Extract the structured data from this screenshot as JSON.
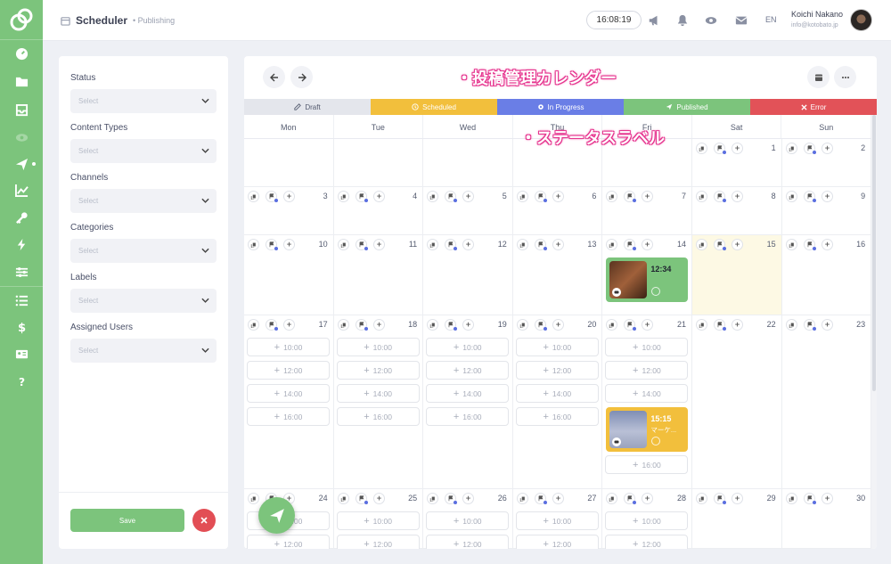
{
  "colors": {
    "accent": "#7cc47c",
    "draft": "#e4e6ec",
    "scheduled": "#f2bf3c",
    "in_progress": "#6a7ee6",
    "published": "#7cc47c",
    "error": "#e25258",
    "today_bg": "#fdf9e4"
  },
  "sidebar": {
    "items": [
      "dashboard-icon",
      "folder-icon",
      "inbox-icon",
      "eye-icon",
      "send-icon",
      "chart-icon",
      "key-icon",
      "bolt-icon",
      "sliders-icon",
      "list-icon",
      "dollar-icon",
      "id-card-icon",
      "help-icon"
    ],
    "active": "send-icon"
  },
  "header": {
    "title": "Scheduler",
    "breadcrumb": "Publishing",
    "clock": "16:08:19",
    "lang": "EN",
    "user_name": "Koichi Nakano",
    "user_email": "info@kotobato.jp"
  },
  "filters": {
    "fields": [
      {
        "label": "Status",
        "placeholder": "Select"
      },
      {
        "label": "Content Types",
        "placeholder": "Select"
      },
      {
        "label": "Channels",
        "placeholder": "Select"
      },
      {
        "label": "Categories",
        "placeholder": "Select"
      },
      {
        "label": "Labels",
        "placeholder": "Select"
      },
      {
        "label": "Assigned Users",
        "placeholder": "Select"
      }
    ],
    "save_label": "Save"
  },
  "statuses": [
    {
      "label": "Draft",
      "icon": "edit-icon"
    },
    {
      "label": "Scheduled",
      "icon": "clock-icon"
    },
    {
      "label": "In Progress",
      "icon": "gear-icon"
    },
    {
      "label": "Published",
      "icon": "send-icon"
    },
    {
      "label": "Error",
      "icon": "close-icon"
    }
  ],
  "weekdays": [
    "Mon",
    "Tue",
    "Wed",
    "Thu",
    "Fri",
    "Sat",
    "Sun"
  ],
  "weeks": [
    [
      "",
      "",
      "",
      "",
      "",
      "1",
      "2"
    ],
    [
      "3",
      "4",
      "5",
      "6",
      "7",
      "8",
      "9"
    ],
    [
      "10",
      "11",
      "12",
      "13",
      "14",
      "15",
      "16"
    ],
    [
      "17",
      "18",
      "19",
      "20",
      "21",
      "22",
      "23"
    ],
    [
      "24",
      "25",
      "26",
      "27",
      "28",
      "29",
      "30"
    ]
  ],
  "today": "15",
  "time_slots": {
    "week4": {
      "mon": [
        "10:00",
        "12:00",
        "14:00",
        "16:00"
      ],
      "tue": [
        "10:00",
        "12:00",
        "14:00",
        "16:00"
      ],
      "wed": [
        "10:00",
        "12:00",
        "14:00",
        "16:00"
      ],
      "thu": [
        "10:00",
        "12:00",
        "14:00",
        "16:00"
      ],
      "fri": [
        "10:00",
        "12:00",
        "14:00",
        "16:00"
      ]
    },
    "week5": [
      "10:00",
      "12:00"
    ]
  },
  "posts": [
    {
      "day": "14",
      "time": "12:34",
      "caption": "",
      "status": "published"
    },
    {
      "day": "21",
      "time": "15:15",
      "caption": "マーケ...",
      "status": "scheduled"
    }
  ],
  "annotations": [
    "・投稿管理カレンダー",
    "・ステータスラベル"
  ]
}
